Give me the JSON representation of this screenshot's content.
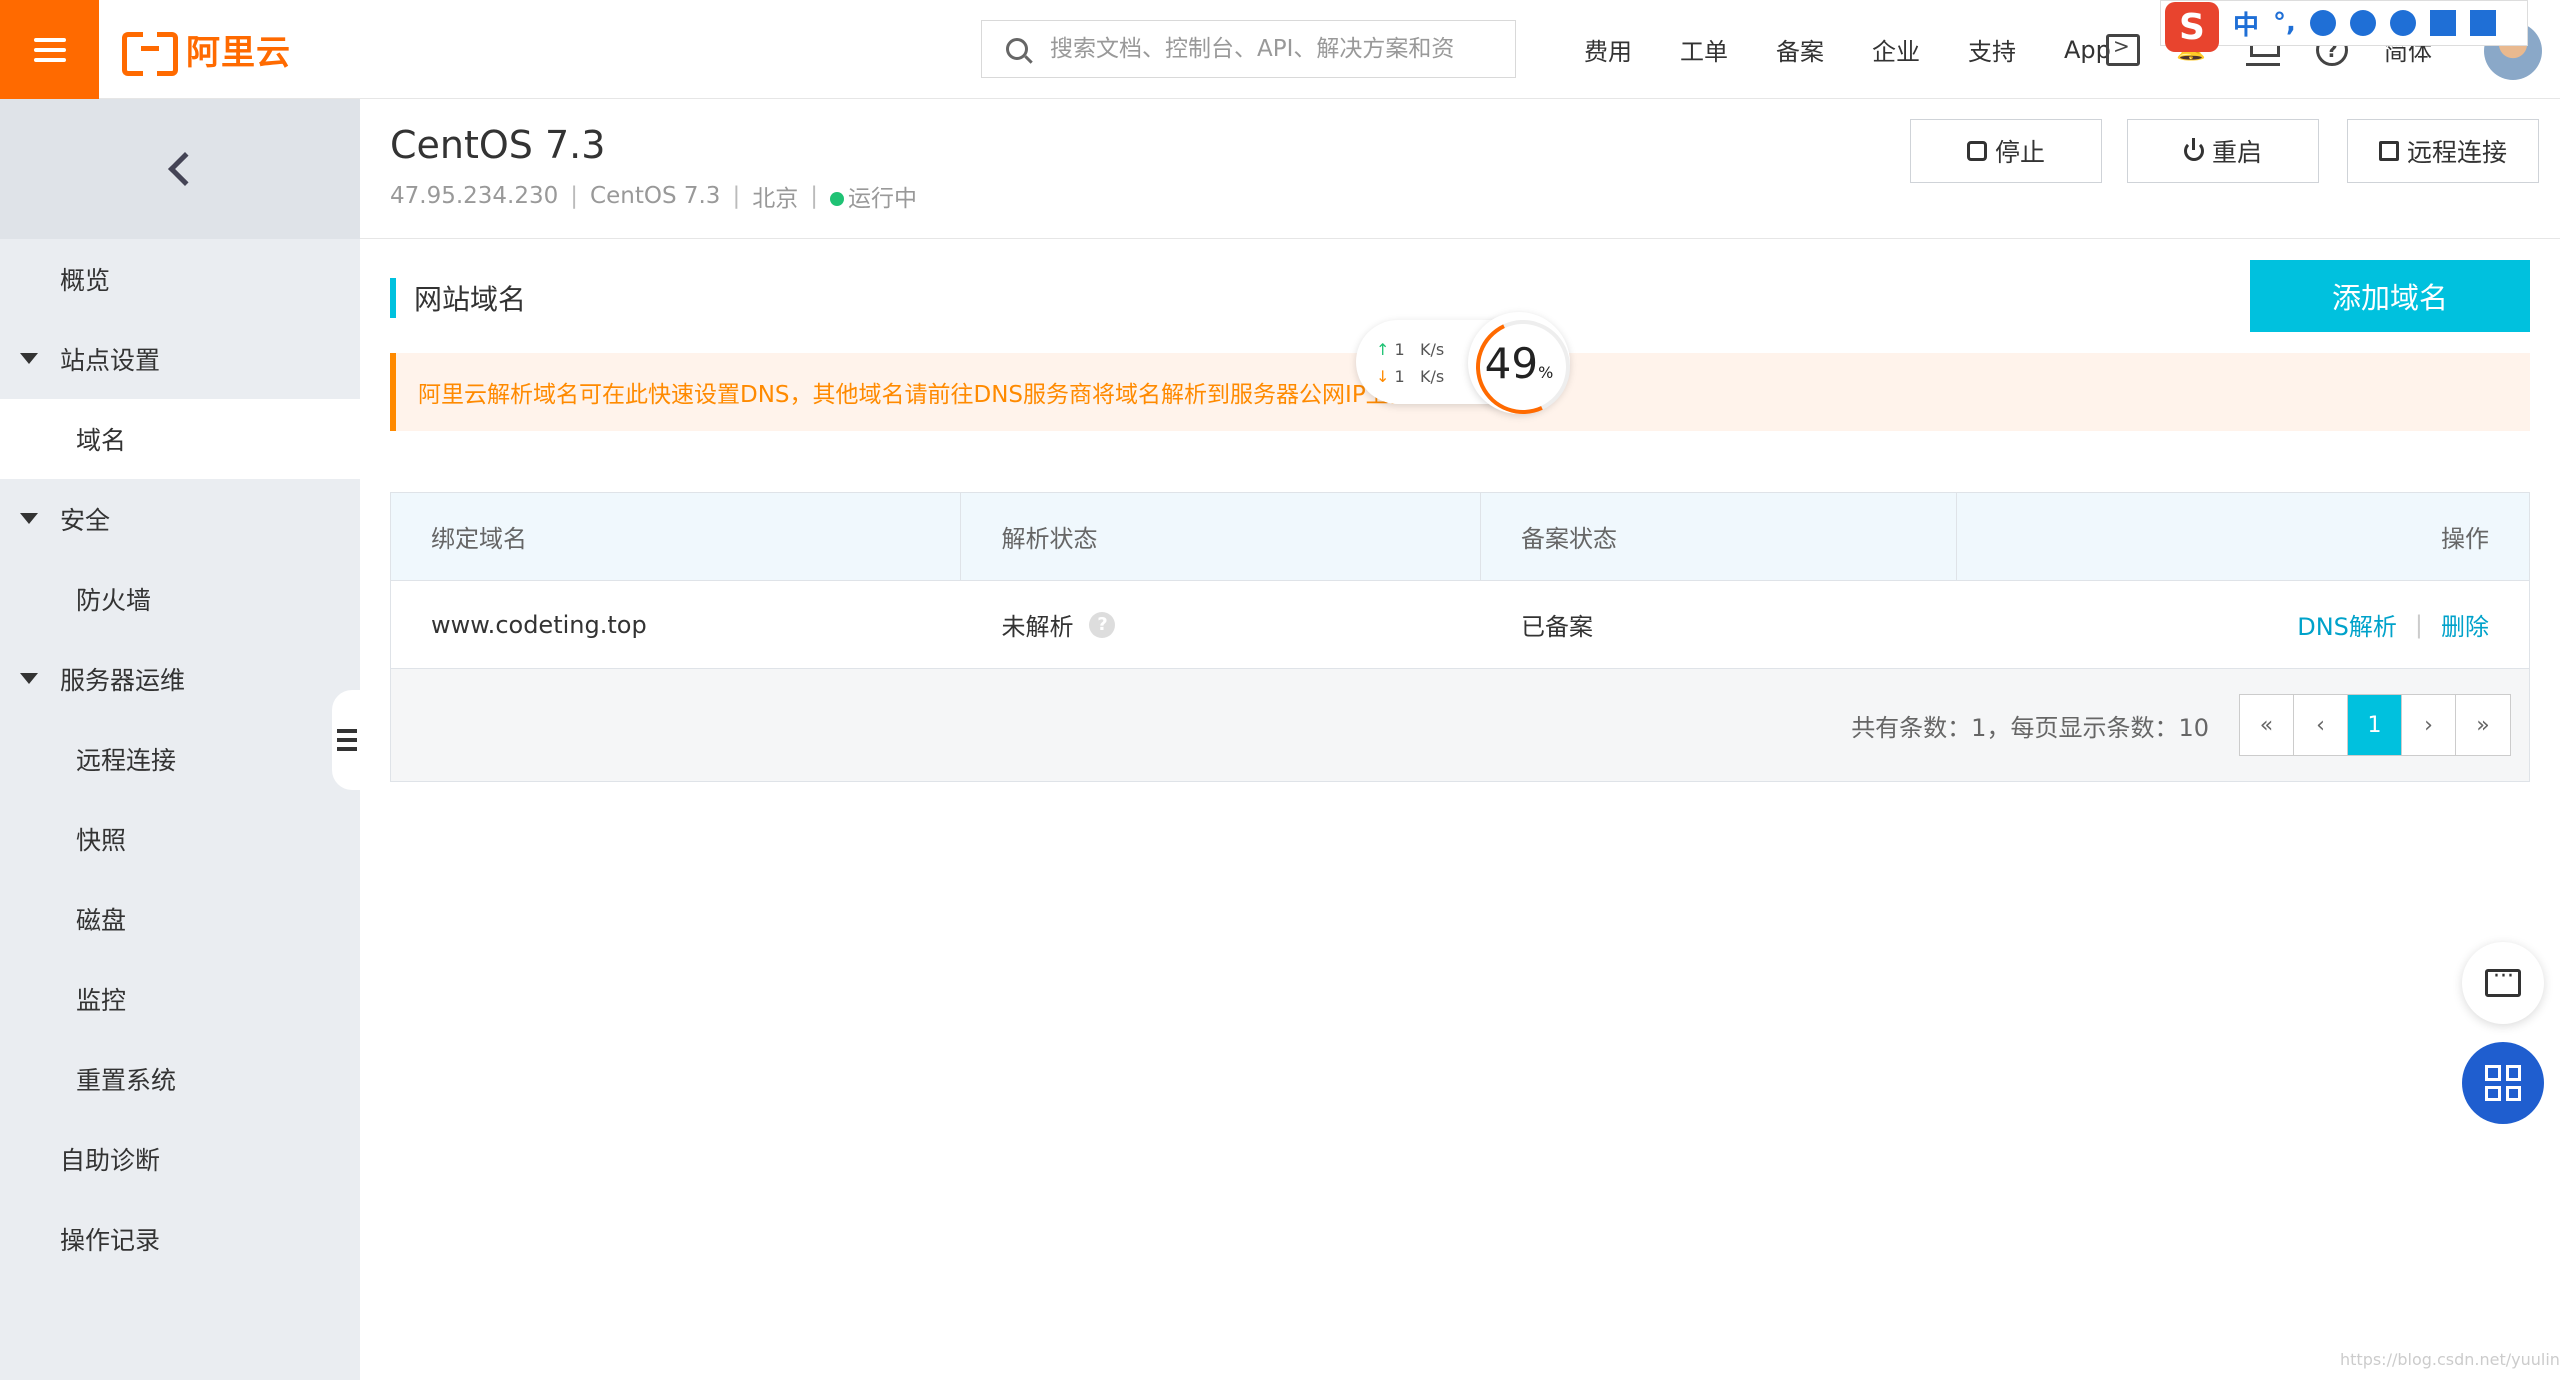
{
  "topbar": {
    "logo_text": "阿里云",
    "search_placeholder": "搜索文档、控制台、API、解决方案和资",
    "nav": [
      "费用",
      "工单",
      "备案",
      "企业",
      "支持",
      "App"
    ],
    "lang_label": "简体"
  },
  "ime": {
    "lang": "中",
    "punct": "°,"
  },
  "sidebar": {
    "items": [
      {
        "label": "概览",
        "level": 1,
        "expandable": false
      },
      {
        "label": "站点设置",
        "level": 1,
        "expandable": true
      },
      {
        "label": "域名",
        "level": 2,
        "active": true
      },
      {
        "label": "安全",
        "level": 1,
        "expandable": true
      },
      {
        "label": "防火墙",
        "level": 2
      },
      {
        "label": "服务器运维",
        "level": 1,
        "expandable": true
      },
      {
        "label": "远程连接",
        "level": 2
      },
      {
        "label": "快照",
        "level": 2
      },
      {
        "label": "磁盘",
        "level": 2
      },
      {
        "label": "监控",
        "level": 2
      },
      {
        "label": "重置系统",
        "level": 2
      },
      {
        "label": "自助诊断",
        "level": 1
      },
      {
        "label": "操作记录",
        "level": 1
      }
    ]
  },
  "instance": {
    "title": "CentOS 7.3",
    "ip": "47.95.234.230",
    "os": "CentOS 7.3",
    "region": "北京",
    "status": "运行中",
    "status_color": "#1fc274"
  },
  "actions": {
    "stop": "停止",
    "restart": "重启",
    "remote": "远程连接"
  },
  "section": {
    "title": "网站域名",
    "add_button": "添加域名",
    "notice": "阿里云解析域名可在此快速设置DNS，其他域名请前往DNS服务商将域名解析到服务器公网IP上。"
  },
  "table": {
    "headers": [
      "绑定域名",
      "解析状态",
      "备案状态",
      "操作"
    ],
    "rows": [
      {
        "domain": "www.codeting.top",
        "dns_status": "未解析",
        "icp_status": "已备案",
        "op_dns": "DNS解析",
        "op_delete": "删除"
      }
    ],
    "pager_info": "共有条数：1，每页显示条数：10",
    "pages": [
      "«",
      "‹",
      "1",
      "›",
      "»"
    ],
    "current_page": "1"
  },
  "speed_widget": {
    "up": "1",
    "down": "1",
    "unit": "K/s",
    "percent": "49",
    "percent_sign": "%"
  },
  "watermark": "https://blog.csdn.net/yuulings",
  "colors": {
    "brand": "#ff6a00",
    "accent": "#00c1de",
    "link": "#00a2ca",
    "notice_text": "#ff8a00"
  }
}
